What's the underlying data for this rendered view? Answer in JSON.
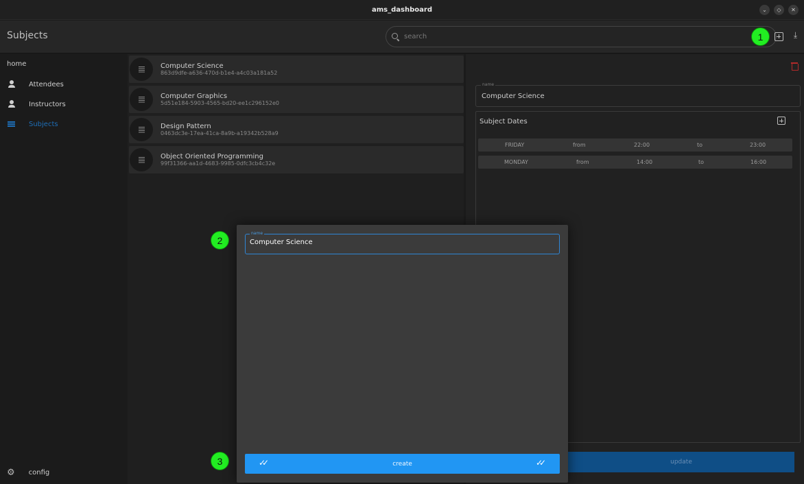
{
  "window": {
    "title": "ams_dashboard",
    "controls": [
      "minimize",
      "maximize",
      "close"
    ]
  },
  "header": {
    "page_title": "Subjects",
    "search_placeholder": "search",
    "badge_1": "1"
  },
  "sidebar": {
    "home_label": "home",
    "items": [
      {
        "label": "Attendees",
        "icon": "person-icon",
        "active": false
      },
      {
        "label": "Instructors",
        "icon": "person-icon",
        "active": false
      },
      {
        "label": "Subjects",
        "icon": "list-icon",
        "active": true
      }
    ],
    "config_label": "config"
  },
  "subjects": [
    {
      "name": "Computer Science",
      "id": "863d9dfe-a636-470d-b1e4-a4c03a181a52"
    },
    {
      "name": "Computer Graphics",
      "id": "5d51e184-5903-4565-bd20-ee1c296152e0"
    },
    {
      "name": "Design Pattern",
      "id": "0463dc3e-17ea-41ca-8a9b-a19342b528a9"
    },
    {
      "name": "Object Oriented Programming",
      "id": "99f31366-aa1d-4683-9985-0dfc3cb4c32e"
    }
  ],
  "detail": {
    "name_legend": "name",
    "name_value": "Computer Science",
    "dates_title": "Subject Dates",
    "dates": [
      {
        "day": "FRIDAY",
        "from_label": "from",
        "start": "22:00",
        "to_label": "to",
        "end": "23:00"
      },
      {
        "day": "MONDAY",
        "from_label": "from",
        "start": "14:00",
        "to_label": "to",
        "end": "16:00"
      }
    ],
    "update_label": "update"
  },
  "modal": {
    "name_legend": "name",
    "name_value": "Computer Science",
    "badge_2": "2",
    "create_label": "create",
    "badge_3": "3"
  },
  "colors": {
    "accent": "#2196f3",
    "sidebar_active": "#1e6fb8",
    "badge": "#22ee22",
    "danger": "#b22a2a"
  }
}
